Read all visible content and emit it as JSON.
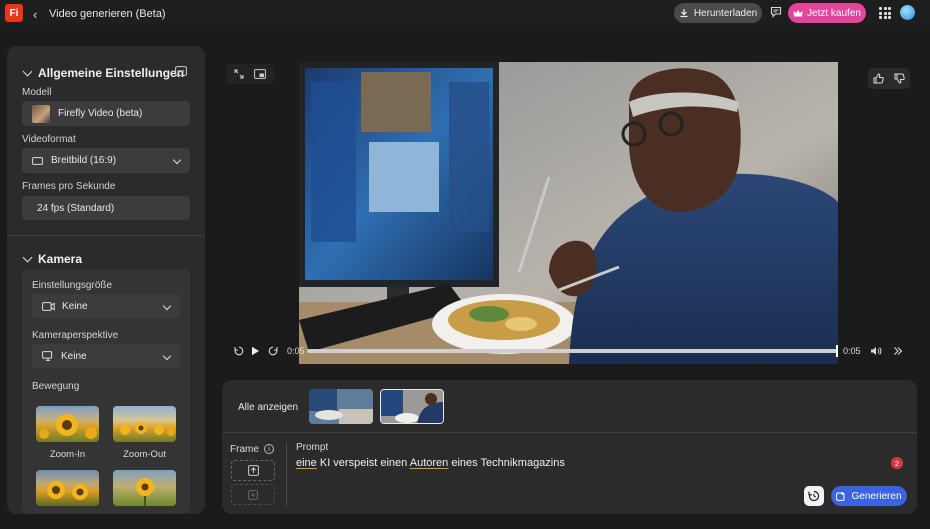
{
  "app": {
    "icon_text": "Fi",
    "title": "Video generieren (Beta)"
  },
  "topbar": {
    "download_label": "Herunterladen",
    "buy_label": "Jetzt kaufen"
  },
  "settings": {
    "general_title": "Allgemeine Einstellungen",
    "model_label": "Modell",
    "model_value": "Firefly Video (beta)",
    "format_label": "Videoformat",
    "format_value": "Breitbild (16:9)",
    "fps_label": "Frames pro Sekunde",
    "fps_value": "24 fps (Standard)"
  },
  "camera": {
    "title": "Kamera",
    "shot_size_label": "Einstellungsgröße",
    "shot_size_value": "Keine",
    "angle_label": "Kameraperspektive",
    "angle_value": "Keine",
    "motion_label": "Bewegung",
    "motion_options": [
      "Zoom-In",
      "Zoom-Out"
    ]
  },
  "player": {
    "current_time": "0:05",
    "total_time": "0:05",
    "progress_fraction": 1.0
  },
  "bottom": {
    "show_all_label": "Alle anzeigen",
    "frame_label": "Frame",
    "prompt_label": "Prompt",
    "prompt_parts": [
      "eine",
      " KI verspeist einen ",
      "Autoren",
      " eines Technikmagazins"
    ],
    "badge_count": "2",
    "generate_label": "Generieren"
  },
  "colors": {
    "buy": "#e3449c",
    "generate": "#3b63e0",
    "badge": "#d9393e",
    "app_icon": "#e8361c"
  }
}
